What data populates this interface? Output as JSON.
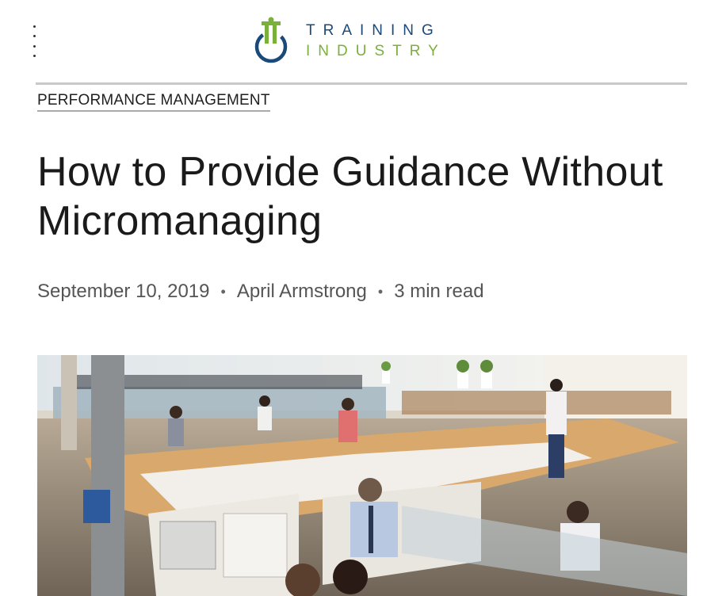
{
  "header": {
    "menu_icon": "vertical-dots-icon",
    "logo": {
      "line1": "TRAINING",
      "line2": "INDUSTRY",
      "brand_blue": "#1a4a7a",
      "brand_green": "#7ab03b"
    }
  },
  "article": {
    "category": "PERFORMANCE MANAGEMENT",
    "title": "How to Provide Guidance Without Micromanaging",
    "date": "September 10, 2019",
    "separator": "•",
    "author": "April Armstrong",
    "read_time": "3 min read"
  },
  "hero_image": {
    "subject": "open-plan-office-photo"
  }
}
